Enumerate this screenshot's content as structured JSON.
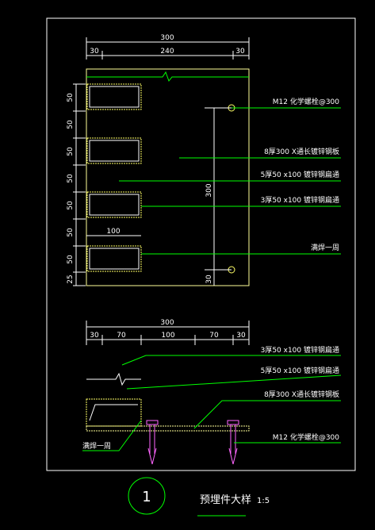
{
  "colors": {
    "background": "#000000",
    "frame": "#ffffff",
    "dim": "#ffffff",
    "leader": "#00ff00",
    "plate": "#ffff99",
    "tube": "#ffff66",
    "anchor": "#ff66ff",
    "note_text": "#ffffff"
  },
  "upper_view": {
    "dims_top": {
      "total": "300",
      "left": "30",
      "mid": "240",
      "right": "30"
    },
    "dims_left": [
      "50",
      "50",
      "50",
      "50",
      "50",
      "50",
      "25"
    ],
    "dim_right": "300",
    "dim_right_bottom": "30",
    "dim_inner": "100",
    "notes": [
      "M12 化学螺栓@300",
      "8厚300 X通长镀锌钢板",
      "5厚50 x100 镀锌钢扁通",
      "3厚50 x100 镀锌钢扁通",
      "满焊一周"
    ]
  },
  "lower_view": {
    "dims_top": {
      "total": "300",
      "d1": "30",
      "d2": "70",
      "d3": "100",
      "d4": "70",
      "d5": "30"
    },
    "notes": [
      "3厚50 x100 镀锌钢扁通",
      "5厚50 x100 镀锌钢扁通",
      "8厚300 X通长镀锌钢板",
      "M12 化学螺栓@300",
      "满焊一周"
    ]
  },
  "title_block": {
    "number": "1",
    "title": "预埋件大样",
    "scale": "1:5"
  }
}
